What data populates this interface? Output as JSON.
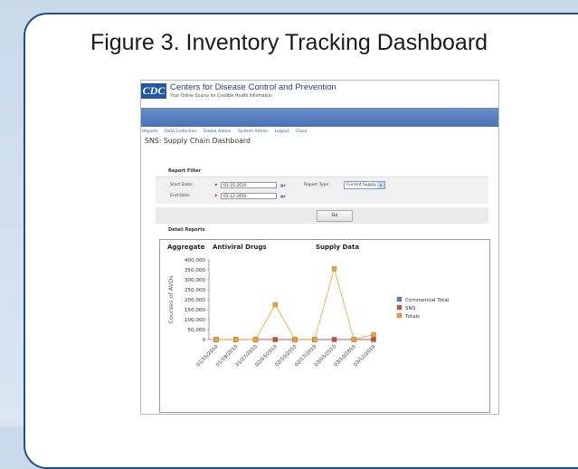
{
  "figure_title": "Figure 3. Inventory Tracking Dashboard",
  "header": {
    "logo_text": "CDC",
    "org_name": "Centers for Disease Control and Prevention",
    "tagline": "Your Online Source for Credible Health Information"
  },
  "nav": [
    "Reports",
    "Data Collection",
    "Global Admin",
    "System Admin",
    "Logout",
    "Close"
  ],
  "page_title": "SNS: Supply Chain Dashboard",
  "report_filter": {
    "heading": "Report Filter",
    "start_label": "Start Date:",
    "start_value": "01-15-2010",
    "end_label": "End Date:",
    "end_value": "03-12-2010",
    "type_label": "Report Type:",
    "type_value": "Current Supply",
    "go_label": "Go"
  },
  "detail_heading": "Detail Reports",
  "chart_data": {
    "type": "line",
    "title_left": "Aggregate",
    "title_mid": "Antiviral Drugs",
    "title_right": "Supply Data",
    "ylabel": "Courses of AVDs",
    "xlabel": "",
    "ylim": [
      0,
      400000
    ],
    "yticks": [
      "400,000",
      "350,000",
      "300,000",
      "250,000",
      "200,000",
      "150,000",
      "100,000",
      "50,000",
      "0"
    ],
    "x": [
      "01/15/2010",
      "01/18/2010",
      "01/27/2010",
      "02/03/2010",
      "02/10/2010",
      "02/17/2010",
      "03/03/2010",
      "03/10/2010",
      "03/12/2010"
    ],
    "series": [
      {
        "name": "Commercial Total",
        "color": "#4f81bd",
        "values": [
          0,
          0,
          0,
          0,
          0,
          0,
          0,
          0,
          0
        ]
      },
      {
        "name": "SNS",
        "color": "#c0504d",
        "values": [
          0,
          0,
          0,
          0,
          0,
          0,
          0,
          0,
          0
        ]
      },
      {
        "name": "Totals",
        "color": "#e8a33d",
        "values": [
          0,
          0,
          0,
          175000,
          0,
          0,
          355000,
          0,
          25000
        ]
      }
    ],
    "legend_position": "right"
  }
}
